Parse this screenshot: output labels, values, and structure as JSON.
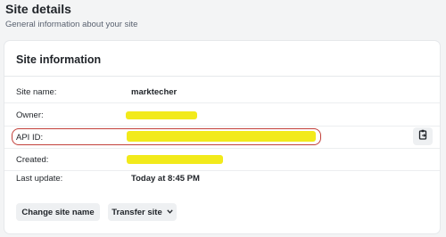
{
  "header": {
    "title": "Site details",
    "subtitle": "General information about your site"
  },
  "card": {
    "title": "Site information",
    "rows": [
      {
        "label": "Site name:",
        "value": "marktecher",
        "redacted": false
      },
      {
        "label": "Owner:",
        "value": "",
        "redacted": true
      },
      {
        "label": "API ID:",
        "value": "",
        "redacted": true,
        "highlighted": true,
        "copy_icon": "copy-to-clipboard-icon"
      },
      {
        "label": "Created:",
        "value": "",
        "redacted": true
      },
      {
        "label": "Last update:",
        "value": "Today at 8:45 PM",
        "redacted": false
      }
    ],
    "buttons": {
      "change_site_name": "Change site name",
      "transfer_site": "Transfer site",
      "transfer_icon": "chevron-down-icon"
    }
  },
  "colors": {
    "redaction": "#f2ea1b",
    "highlight_border": "#c2403a",
    "button_bg": "#eef0f2"
  }
}
